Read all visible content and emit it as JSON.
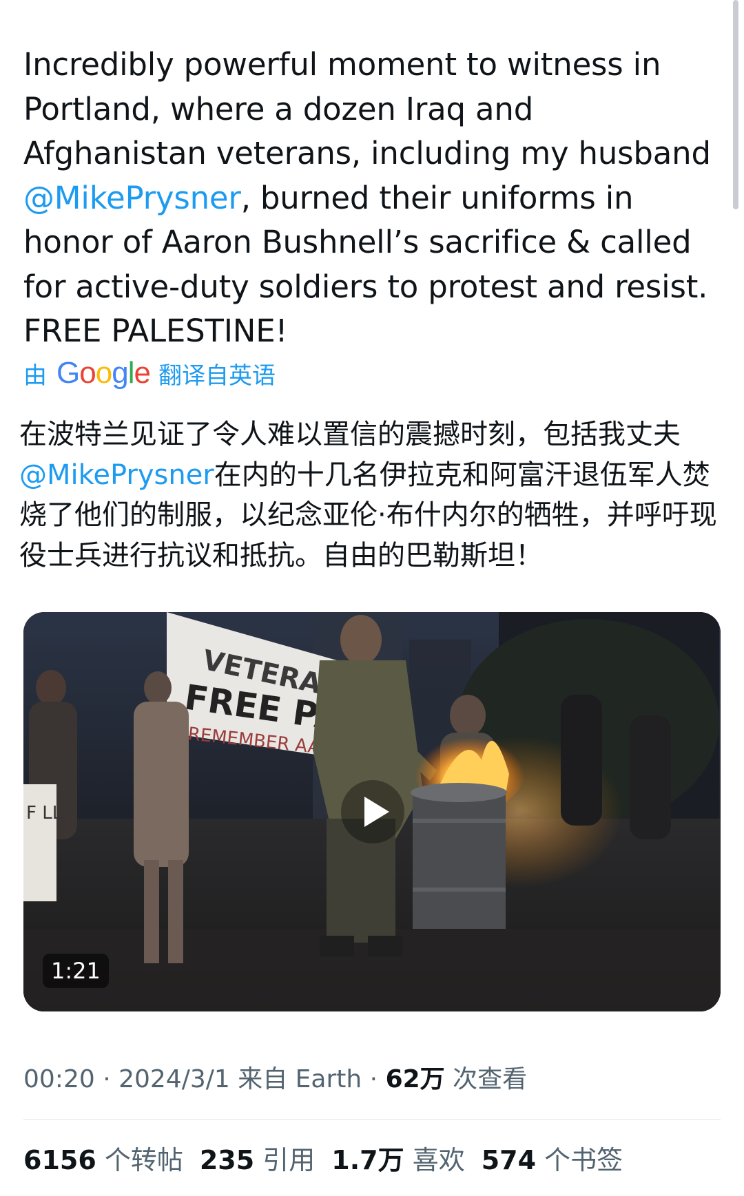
{
  "tweet": {
    "text_before": "Incredibly powerful moment to witness in Portland, where a dozen Iraq and Afghanistan veterans, including my husband ",
    "mention": "@MikePrysner",
    "text_after": ", burned their uniforms in honor of Aaron Bushnell’s sacrifice & called for active-duty soldiers to protest and resist. FREE PALESTINE!"
  },
  "translation": {
    "prefix": "由",
    "google": [
      "G",
      "o",
      "o",
      "g",
      "l",
      "e"
    ],
    "suffix": "翻译自英语",
    "text_line1": "在波特兰见证了令人难以置信的震撼时刻，包括我丈夫",
    "mention": "@MikePrysner",
    "text_rest": "在内的十几名伊拉克和阿富汗退伍军人焚烧了他们的制服，以纪念亚伦·布什内尔的牺牲，并呼吁现役士兵进行抗议和抵抗。自由的巴勒斯坦！"
  },
  "media": {
    "duration": "1:21",
    "banner_line1": "VETERANS",
    "banner_line2": "FREE PAL",
    "banner_line3": "REMEMBER AA",
    "sign_text": "F\nLL"
  },
  "meta": {
    "time": "00:20",
    "sep1": " · ",
    "date": "2024/3/1",
    "source": " 来自 Earth",
    "sep2": " · ",
    "views_count": "62万",
    "views_label": " 次查看"
  },
  "stats": [
    {
      "count": "6156",
      "label": " 个转帖"
    },
    {
      "count": "235",
      "label": " 引用"
    },
    {
      "count": "1.7万",
      "label": " 喜欢"
    },
    {
      "count": "574",
      "label": " 个书签"
    }
  ],
  "colors": {
    "accent": "#1d9bf0",
    "text": "#0f1419",
    "secondary": "#536471",
    "google_blue": "#4285F4",
    "google_red": "#EA4335",
    "google_yellow": "#FBBC05",
    "google_green": "#34A853"
  }
}
